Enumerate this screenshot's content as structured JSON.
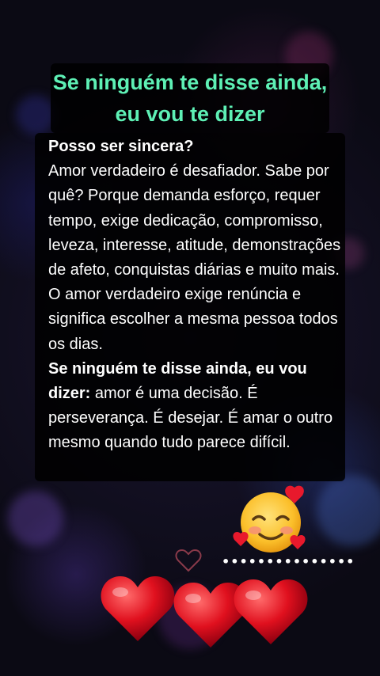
{
  "post": {
    "title_line1": "Se ninguém te disse ainda,",
    "title_line2": "eu vou te dizer",
    "p1_bold": "Posso ser sincera?",
    "p1_text": "Amor verdadeiro é desafiador. Sabe por quê? Porque demanda esforço, requer tempo, exige dedicação, compromisso, leveza, interesse, atitude, demonstrações de afeto, conquistas diárias e muito mais.",
    "p2_text": "O amor verdadeiro exige renúncia e significa escolher a mesma pessoa todos os dias.",
    "p3_bold": "Se ninguém te disse ainda, eu vou dizer:",
    "p3_text": " amor é uma decisão. É perseverança. É desejar. É amar o outro mesmo quando tudo parece difícil."
  },
  "decorations": {
    "dots": "•••••••••••••••",
    "icons": [
      "smiling-face-with-hearts-icon",
      "heart-outline-icon",
      "red-heart-icon"
    ],
    "colors": {
      "title": "#5ef0b5",
      "text": "#ffffff",
      "text_background": "#000000",
      "heart": "#e0101e"
    }
  }
}
